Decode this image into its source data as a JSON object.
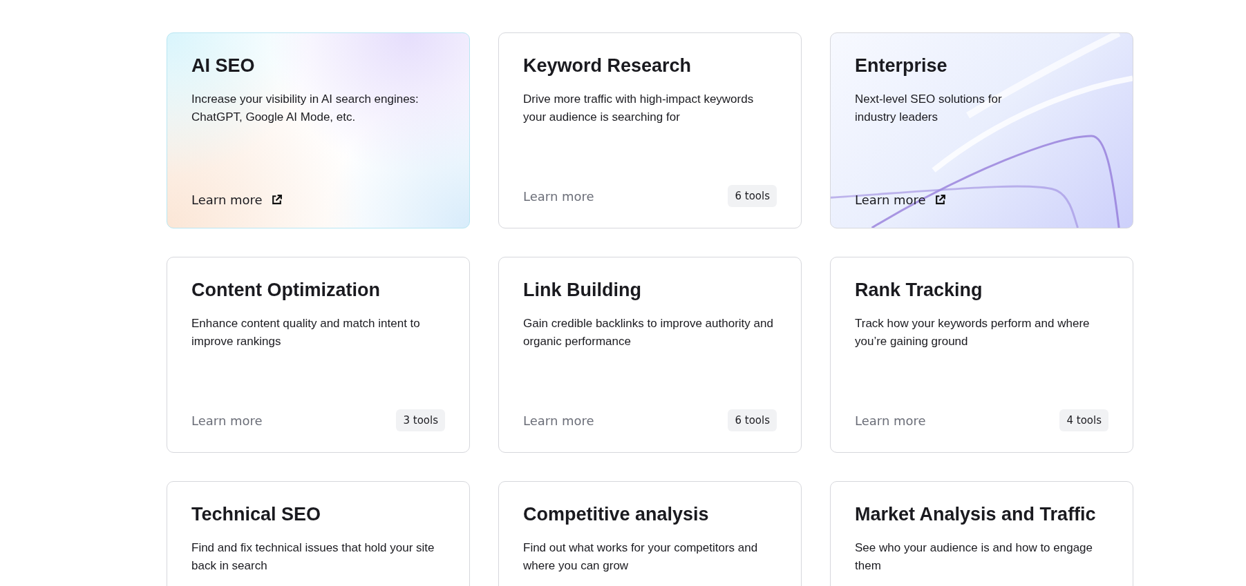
{
  "cards": [
    {
      "kind": "ai",
      "title": "AI SEO",
      "description": "Increase your visibility in AI search engines: ChatGPT, Google AI Mode, etc.",
      "link": "Learn more"
    },
    {
      "kind": "tools",
      "title": "Keyword Research",
      "description": "Drive more traffic with high-impact keywords your audience is searching for",
      "link": "Learn more",
      "badge": "6 tools"
    },
    {
      "kind": "enterprise",
      "title": "Enterprise",
      "description": "Next-level SEO solutions for industry leaders",
      "link": "Learn more"
    },
    {
      "kind": "tools",
      "title": "Content Optimization",
      "description": "Enhance content quality and match intent to improve rankings",
      "link": "Learn more",
      "badge": "3 tools"
    },
    {
      "kind": "tools",
      "title": "Link Building",
      "description": "Gain credible backlinks to improve authority and organic performance",
      "link": "Learn more",
      "badge": "6 tools"
    },
    {
      "kind": "tools",
      "title": "Rank Tracking",
      "description": "Track how your keywords perform and where you’re gaining ground",
      "link": "Learn more",
      "badge": "4 tools"
    },
    {
      "kind": "tools",
      "title": "Technical SEO",
      "description": "Find and fix technical issues that hold your site back in search"
    },
    {
      "kind": "tools",
      "title": "Competitive analysis",
      "description": "Find out what works for your competitors and where you can grow"
    },
    {
      "kind": "tools",
      "title": "Market Analysis and Traffic",
      "description": "See who your audience is and how to engage them"
    }
  ]
}
